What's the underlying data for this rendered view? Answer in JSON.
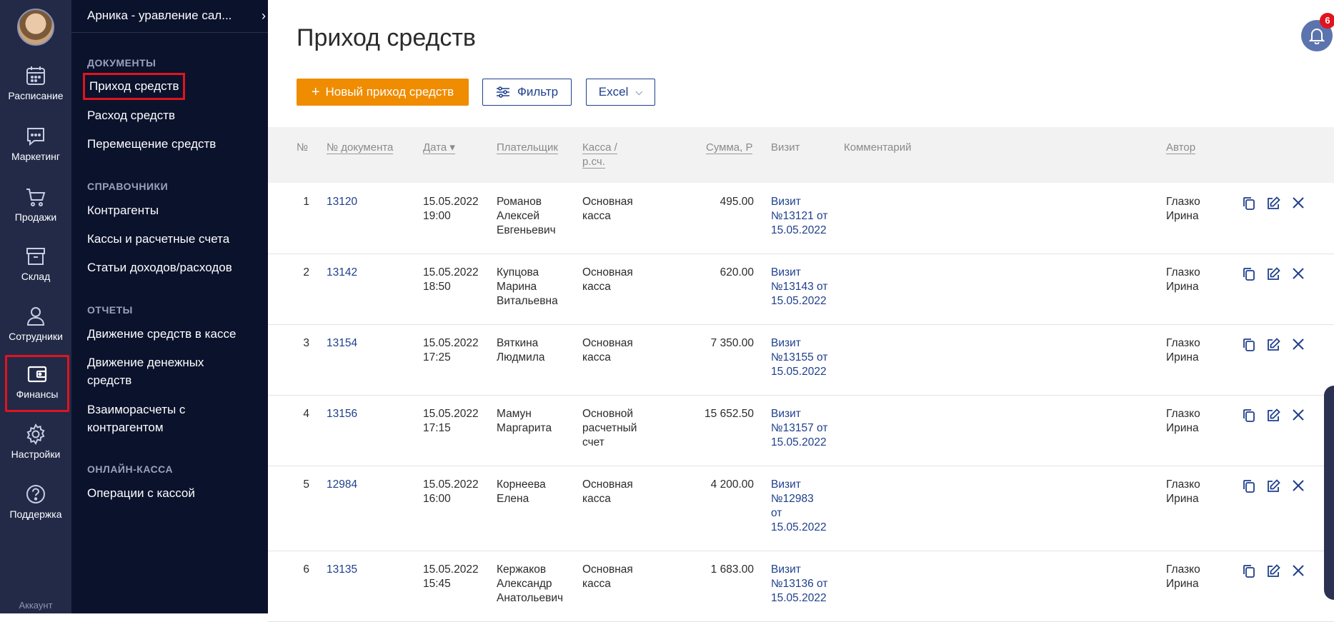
{
  "rail": {
    "items": [
      {
        "label": "Расписание",
        "icon": "calendar-icon"
      },
      {
        "label": "Маркетинг",
        "icon": "chat-icon"
      },
      {
        "label": "Продажи",
        "icon": "cart-icon"
      },
      {
        "label": "Склад",
        "icon": "box-icon"
      },
      {
        "label": "Сотрудники",
        "icon": "person-icon"
      },
      {
        "label": "Финансы",
        "icon": "wallet-icon",
        "active": true
      },
      {
        "label": "Настройки",
        "icon": "gear-icon"
      },
      {
        "label": "Поддержка",
        "icon": "question-icon"
      }
    ],
    "account": "Аккаунт"
  },
  "subnav": {
    "org": "Арника - уравление сал...",
    "sections": [
      {
        "title": "ДОКУМЕНТЫ",
        "links": [
          "Приход средств",
          "Расход средств",
          "Перемещение средств"
        ]
      },
      {
        "title": "СПРАВОЧНИКИ",
        "links": [
          "Контрагенты",
          "Кассы и расчетные счета",
          "Статьи доходов/расходов"
        ]
      },
      {
        "title": "ОТЧЕТЫ",
        "links": [
          "Движение средств в кассе",
          "Движение денежных средств",
          "Взаиморасчеты с контрагентом"
        ]
      },
      {
        "title": "ОНЛАЙН-КАССА",
        "links": [
          "Операции с кассой"
        ]
      }
    ],
    "active_link": "Приход средств"
  },
  "page": {
    "title": "Приход средств",
    "notifications": "6",
    "buttons": {
      "new": "Новый приход средств",
      "filter": "Фильтр",
      "excel": "Excel"
    }
  },
  "table": {
    "headers": {
      "n": "№",
      "doc": "№ документа",
      "date": "Дата ▾",
      "payer": "Плательщик",
      "cash1": "Касса /",
      "cash2": "р.сч.",
      "sum": "Сумма, Р",
      "visit": "Визит",
      "comment": "Комментарий",
      "author": "Автор"
    },
    "rows": [
      {
        "n": "1",
        "doc": "13120",
        "date": [
          "15.05.2022",
          "19:00"
        ],
        "payer": [
          "Романов",
          "Алексей",
          "Евгеньевич"
        ],
        "cash": [
          "Основная",
          "касса"
        ],
        "sum": "495.00",
        "visit": [
          "Визит",
          "№13121 от",
          "15.05.2022"
        ],
        "comment": "",
        "author": [
          "Глазко",
          "Ирина"
        ]
      },
      {
        "n": "2",
        "doc": "13142",
        "date": [
          "15.05.2022",
          "18:50"
        ],
        "payer": [
          "Купцова",
          "Марина",
          "Витальевна"
        ],
        "cash": [
          "Основная",
          "касса"
        ],
        "sum": "620.00",
        "visit": [
          "Визит",
          "№13143 от",
          "15.05.2022"
        ],
        "comment": "",
        "author": [
          "Глазко",
          "Ирина"
        ]
      },
      {
        "n": "3",
        "doc": "13154",
        "date": [
          "15.05.2022",
          "17:25"
        ],
        "payer": [
          "Вяткина",
          "Людмила"
        ],
        "cash": [
          "Основная",
          "касса"
        ],
        "sum": "7 350.00",
        "visit": [
          "Визит",
          "№13155 от",
          "15.05.2022"
        ],
        "comment": "",
        "author": [
          "Глазко",
          "Ирина"
        ]
      },
      {
        "n": "4",
        "doc": "13156",
        "date": [
          "15.05.2022",
          "17:15"
        ],
        "payer": [
          "Мамун",
          "Маргарита"
        ],
        "cash": [
          "Основной",
          "расчетный",
          "счет"
        ],
        "sum": "15 652.50",
        "visit": [
          "Визит",
          "№13157 от",
          "15.05.2022"
        ],
        "comment": "",
        "author": [
          "Глазко",
          "Ирина"
        ]
      },
      {
        "n": "5",
        "doc": "12984",
        "date": [
          "15.05.2022",
          "16:00"
        ],
        "payer": [
          "Корнеева",
          "Елена"
        ],
        "cash": [
          "Основная",
          "касса"
        ],
        "sum": "4 200.00",
        "visit": [
          "Визит",
          "№12983",
          "от",
          "15.05.2022"
        ],
        "comment": "",
        "author": [
          "Глазко",
          "Ирина"
        ]
      },
      {
        "n": "6",
        "doc": "13135",
        "date": [
          "15.05.2022",
          "15:45"
        ],
        "payer": [
          "Кержаков",
          "Александр",
          "Анатольевич"
        ],
        "cash": [
          "Основная",
          "касса"
        ],
        "sum": "1 683.00",
        "visit": [
          "Визит",
          "№13136 от",
          "15.05.2022"
        ],
        "comment": "",
        "author": [
          "Глазко",
          "Ирина"
        ]
      }
    ]
  },
  "colors": {
    "rail_bg": "#222a48",
    "subnav_bg": "#0b122c",
    "accent_orange": "#f08c00",
    "link_blue": "#1e3f8c",
    "highlight_red": "#e0141e"
  }
}
